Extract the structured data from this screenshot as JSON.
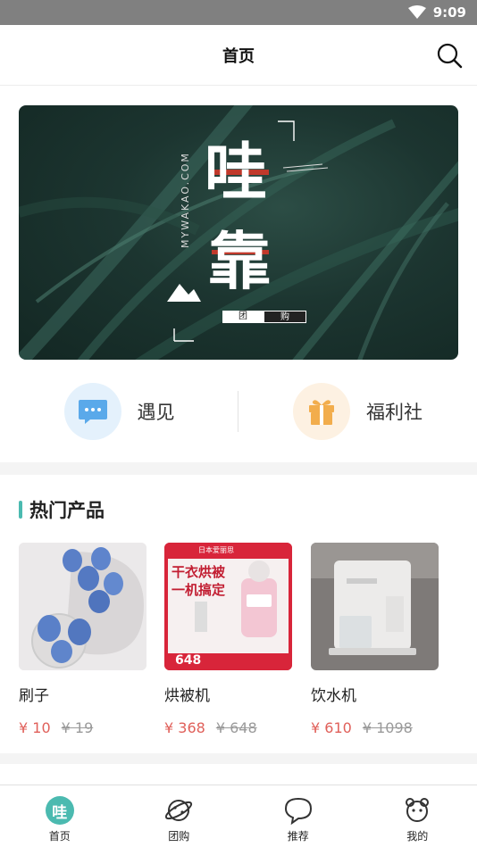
{
  "status_bar": {
    "time": "9:09"
  },
  "header": {
    "title": "首页"
  },
  "banner": {
    "brand_char_1": "哇",
    "brand_char_2": "靠",
    "url_text": "MYWAKAO.COM",
    "tag_1": "团",
    "tag_2": "购"
  },
  "quick_links": [
    {
      "label": "遇见",
      "icon": "chat-bubble-icon",
      "bg": "#e4f1fc",
      "color": "#5aa9ea"
    },
    {
      "label": "福利社",
      "icon": "gift-icon",
      "bg": "#fdf1e2",
      "color": "#f2ad4c"
    }
  ],
  "hot_section": {
    "title": "热门产品"
  },
  "products": [
    {
      "name": "刷子",
      "price": "¥ 10",
      "original_price": "¥ 19"
    },
    {
      "name": "烘被机",
      "price": "¥ 368",
      "original_price": "¥ 648",
      "ad_headline_1": "干衣烘被",
      "ad_headline_2": "一机搞定",
      "ad_price": "648",
      "ad_brand": "日本爱丽思"
    },
    {
      "name": "饮水机",
      "price": "¥ 610",
      "original_price": "¥ 1098"
    }
  ],
  "tab_bar": [
    {
      "label": "首页",
      "icon": "home-wa-icon",
      "active": true
    },
    {
      "label": "团购",
      "icon": "planet-icon",
      "active": false
    },
    {
      "label": "推荐",
      "icon": "chat-icon",
      "active": false
    },
    {
      "label": "我的",
      "icon": "profile-icon",
      "active": false
    }
  ],
  "colors": {
    "accent": "#4bbab0",
    "price": "#e0605a"
  }
}
